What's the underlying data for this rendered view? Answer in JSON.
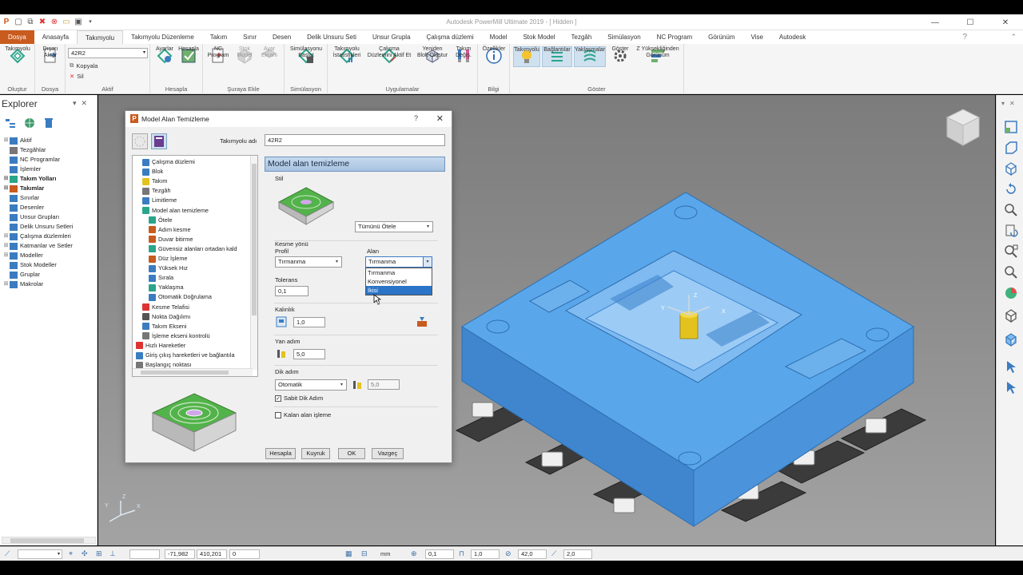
{
  "app": {
    "title": "Autodesk PowerMill Ultimate 2019 - [ Hidden ]"
  },
  "tabs": [
    "Dosya",
    "Anasayfa",
    "Takımyolu",
    "Takımyolu Düzenleme",
    "Takım",
    "Sınır",
    "Desen",
    "Delik Unsuru Seti",
    "Unsur Grupla",
    "Çalışma düzlemi",
    "Model",
    "Stok Model",
    "Tezgâh",
    "Simülasyon",
    "NC Program",
    "Görünüm",
    "Vise",
    "Autodesk"
  ],
  "ribbon": {
    "groups": {
      "olustur": "Oluştur",
      "dosya": "Dosya",
      "aktif": "Aktif",
      "hesapla": "Hesapla",
      "suraya_ekle": "Şuraya Ekle",
      "simulasyon": "Simülasyon",
      "uygulamalar": "Uygulamalar",
      "bilgi": "Bilgi",
      "goster": "Göster"
    },
    "buttons": {
      "takimyolu": "Takımyolu",
      "disari_aktar": "Dışarı\nAktar",
      "kopyala": "Kopyala",
      "sil": "Sil",
      "ayarlar": "Ayarlar",
      "hesapla": "Hesapla",
      "nc_program": "NC\nProgram",
      "stok_model": "Stok\nModel",
      "ayar_ekrani": "Ayar\nEkranı",
      "sim_baslat": "Simülasyonu\nBaşlat",
      "takimyolu_ist": "Takımyolu\nİstatistikleri",
      "calisma_duzlemini": "Çalışma\nDüzlemini Aktif Et",
      "yeniden_blok": "Yeniden\nBlok Oluştur",
      "takim_degis": "Takım\nDeğiş.",
      "ozellikler": "Özellikler",
      "takimyolu_show": "Takımyolu",
      "baglantilar": "Bağlantılar",
      "yaklasmalar": "Yaklaşmalar",
      "goster": "Göster",
      "z_yukseklik": "Z Yüksekliğinden\nGörünüm"
    },
    "active_toolpath": "42R2"
  },
  "explorer": {
    "title": "Explorer",
    "items": [
      {
        "label": "Aktif",
        "bold": false,
        "expand": "+"
      },
      {
        "label": "Tezgâhlar",
        "bold": false,
        "expand": ""
      },
      {
        "label": "NC Programlar",
        "bold": false,
        "expand": ""
      },
      {
        "label": "İşlemler",
        "bold": false,
        "expand": ""
      },
      {
        "label": "Takım Yolları",
        "bold": true,
        "expand": "+"
      },
      {
        "label": "Takımlar",
        "bold": true,
        "expand": "+"
      },
      {
        "label": "Sınırlar",
        "bold": false,
        "expand": ""
      },
      {
        "label": "Desenler",
        "bold": false,
        "expand": ""
      },
      {
        "label": "Unsur Grupları",
        "bold": false,
        "expand": ""
      },
      {
        "label": "Delik Unsuru Setleri",
        "bold": false,
        "expand": ""
      },
      {
        "label": "Çalışma düzlemleri",
        "bold": false,
        "expand": "+"
      },
      {
        "label": "Katmanlar ve Setler",
        "bold": false,
        "expand": "+"
      },
      {
        "label": "Modeller",
        "bold": false,
        "expand": "+"
      },
      {
        "label": "Stok Modeller",
        "bold": false,
        "expand": ""
      },
      {
        "label": "Gruplar",
        "bold": false,
        "expand": ""
      },
      {
        "label": "Makrolar",
        "bold": false,
        "expand": "+"
      }
    ]
  },
  "dialog": {
    "title": "Model Alan Temizleme",
    "name_label": "Takımyolu adı",
    "name_value": "42R2",
    "tree": [
      "Çalışma düzlemi",
      "Blok",
      "Takım",
      "Tezgâh",
      "Limitleme",
      "Model alan temizleme",
      "Ötele",
      "Adım kesme",
      "Duvar bitirme",
      "Güvensiz alanları ortadan kald",
      "Düz İşleme",
      "Yüksek Hız",
      "Sırala",
      "Yaklaşma",
      "Otomatik Doğrulama",
      "Kesme Telafisi",
      "Nokta Dağılımı",
      "Takım Ekseni",
      "İşleme ekseni kontrolü",
      "Hızlı Hareketler",
      "Giriş çıkış hareketleri ve bağlantıla",
      "Başlangıç noktası"
    ],
    "panel_title": "Model alan temizleme",
    "stil_label": "Stil",
    "stil_value": "Tümünü Ötele",
    "kesme_yonu": "Kesme yönü",
    "profil_label": "Profil",
    "profil_value": "Tırmanma",
    "alan_label": "Alan",
    "alan_value": "Tırmanma",
    "alan_options": [
      "Tırmanma",
      "Konvensiyonel",
      "İkisi"
    ],
    "alan_highlight": "İkisi",
    "tolerans_label": "Tolerans",
    "tolerans_value": "0,1",
    "kalinlik_label": "Kalınlık",
    "kalinlik_value": "1,0",
    "yan_adim_label": "Yan adım",
    "yan_adim_value": "5,0",
    "dik_adim_label": "Dik adım",
    "dik_adim_mode": "Otomatik",
    "dik_adim_value": "5,0",
    "sabit_dik_adim": "Sabit Dik Adım",
    "kalan_alan": "Kalan alan işleme",
    "btn_hesapla": "Hesapla",
    "btn_kuyruk": "Kuyruk",
    "btn_ok": "OK",
    "btn_vazgec": "Vazgeç"
  },
  "viewport": {
    "axis_x": "X",
    "axis_y": "Y",
    "axis_z": "Z"
  },
  "status": {
    "x": "-71,982",
    "y": "410,201",
    "z": "0",
    "unit": "mm",
    "tol": "0,1",
    "thick": "1,0",
    "angle": "42,0",
    "step": "2,0"
  },
  "colors": {
    "file_tab": "#c85b1d",
    "part_blue": "#4f9be0",
    "panel_head": "#b5cde6",
    "highlight": "#2b74c7"
  }
}
